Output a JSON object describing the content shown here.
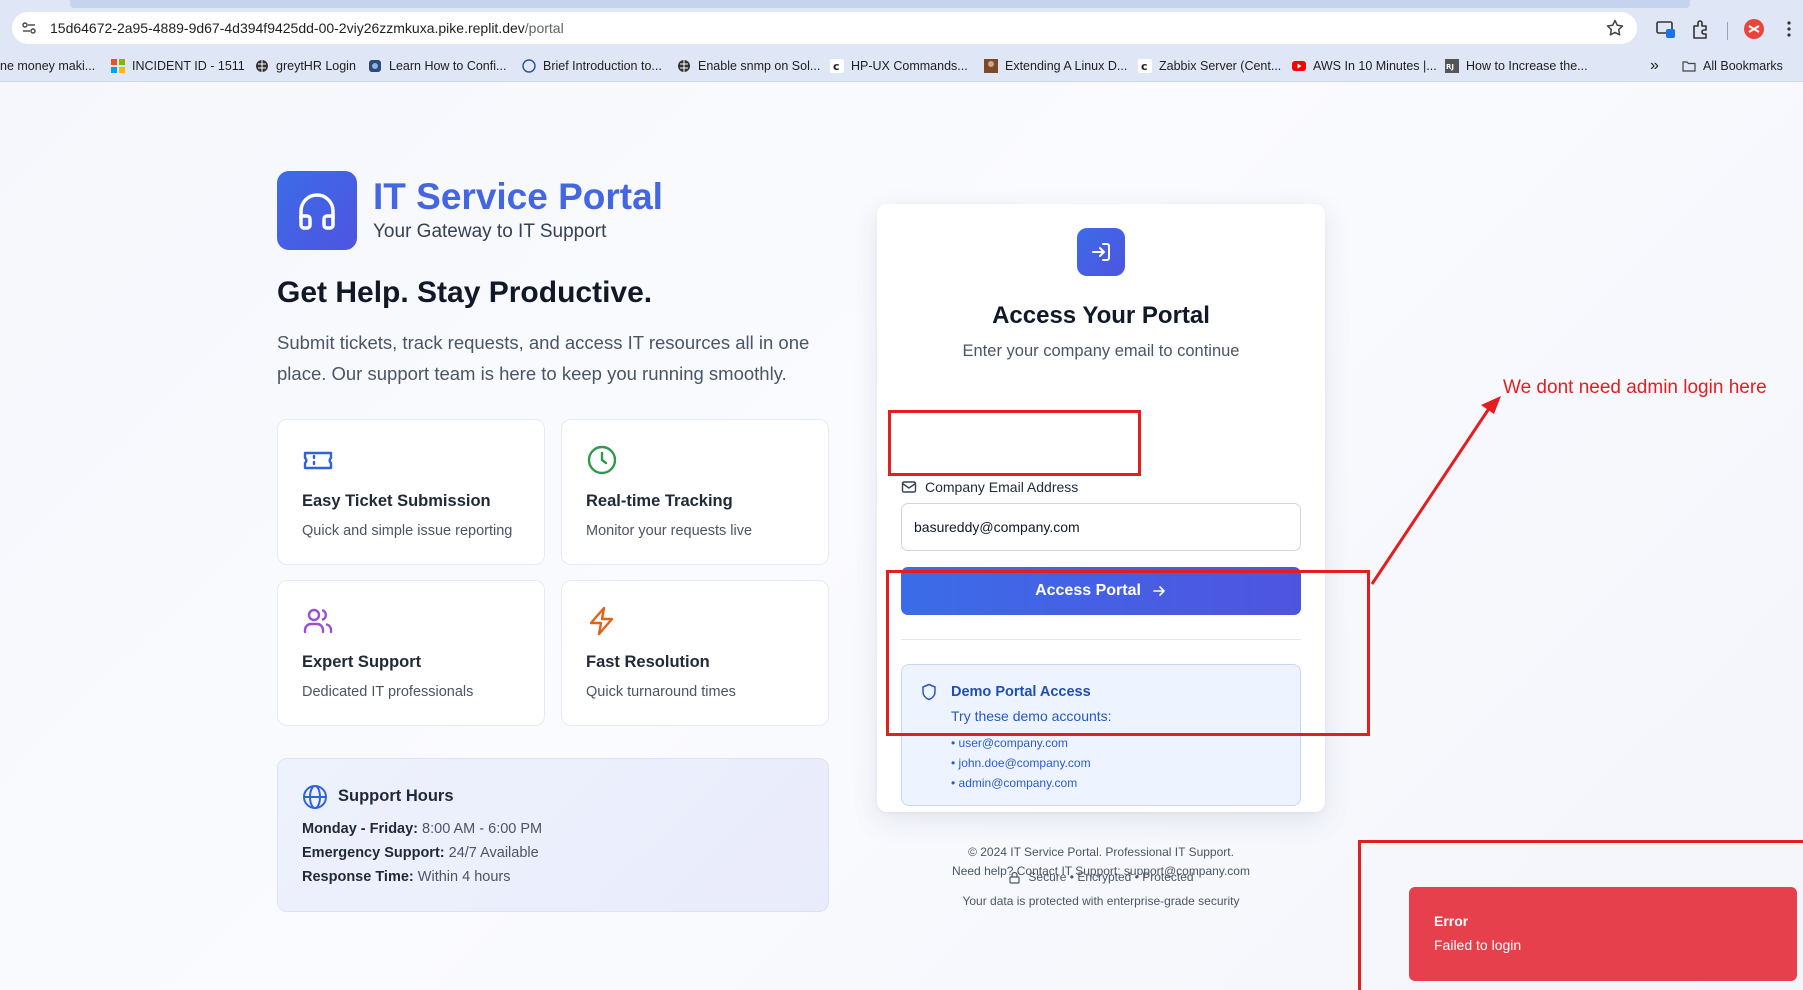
{
  "browser": {
    "url_host": "15d64672-2a95-4889-9d67-4d394f9425dd-00-2viy26zzmkuxa.pike.replit.dev",
    "url_path": "/portal",
    "bookmarks": [
      {
        "label": "ne money maki...",
        "icon": "blank"
      },
      {
        "label": "INCIDENT ID - 1511",
        "icon": "ms-grid-icon"
      },
      {
        "label": "greytHR Login",
        "icon": "globe-icon"
      },
      {
        "label": "Learn How to Confi...",
        "icon": "site-icon"
      },
      {
        "label": "Brief Introduction to...",
        "icon": "circle-icon"
      },
      {
        "label": "Enable snmp on Sol...",
        "icon": "globe-icon"
      },
      {
        "label": "HP-UX Commands...",
        "icon": "c-icon"
      },
      {
        "label": "Extending A Linux D...",
        "icon": "photo-icon"
      },
      {
        "label": "Zabbix Server (Cent...",
        "icon": "c-icon"
      },
      {
        "label": "AWS In 10 Minutes |...",
        "icon": "youtube-icon"
      },
      {
        "label": "How to Increase the...",
        "icon": "rj-icon"
      }
    ],
    "all_bookmarks": "All Bookmarks",
    "more_chevron": "»"
  },
  "brand": {
    "title": "IT Service Portal",
    "subtitle": "Your Gateway to IT Support"
  },
  "hero": {
    "title": "Get Help. Stay Productive.",
    "text": "Submit tickets, track requests, and access IT resources all in one place. Our support team is here to keep you running smoothly."
  },
  "features": [
    {
      "title": "Easy Ticket Submission",
      "desc": "Quick and simple issue reporting",
      "icon": "ticket-icon"
    },
    {
      "title": "Real-time Tracking",
      "desc": "Monitor your requests live",
      "icon": "clock-icon"
    },
    {
      "title": "Expert Support",
      "desc": "Dedicated IT professionals",
      "icon": "users-icon"
    },
    {
      "title": "Fast Resolution",
      "desc": "Quick turnaround times",
      "icon": "lightning-icon"
    }
  ],
  "support_hours": {
    "title": "Support Hours",
    "rows": [
      {
        "label": "Monday - Friday:",
        "value": "8:00 AM - 6:00 PM"
      },
      {
        "label": "Emergency Support:",
        "value": "24/7 Available"
      },
      {
        "label": "Response Time:",
        "value": "Within 4 hours"
      }
    ]
  },
  "login": {
    "title": "Access Your Portal",
    "subtitle": "Enter your company email to continue",
    "email_label": "Company Email Address",
    "email_value": "basureddy@company.com",
    "submit_label": "Access Portal",
    "demo_title": "Demo Portal Access",
    "demo_subtitle": "Try these demo accounts:",
    "demo_accounts": [
      "• user@company.com",
      "• john.doe@company.com",
      "• admin@company.com"
    ],
    "secure_text": "Secure • Encrypted • Protected",
    "secure_sub": "Your data is protected with enterprise-grade security"
  },
  "footer": {
    "line1": "© 2024 IT Service Portal. Professional IT Support.",
    "line2": "Need help? Contact IT Support: support@company.com"
  },
  "toast": {
    "title": "Error",
    "message": "Failed to login"
  },
  "annotation": {
    "note": "We dont need admin login here"
  },
  "colors": {
    "brand_blue": "#4466e2",
    "error_red": "#e5404c",
    "annotation_red": "#e41e1e"
  }
}
